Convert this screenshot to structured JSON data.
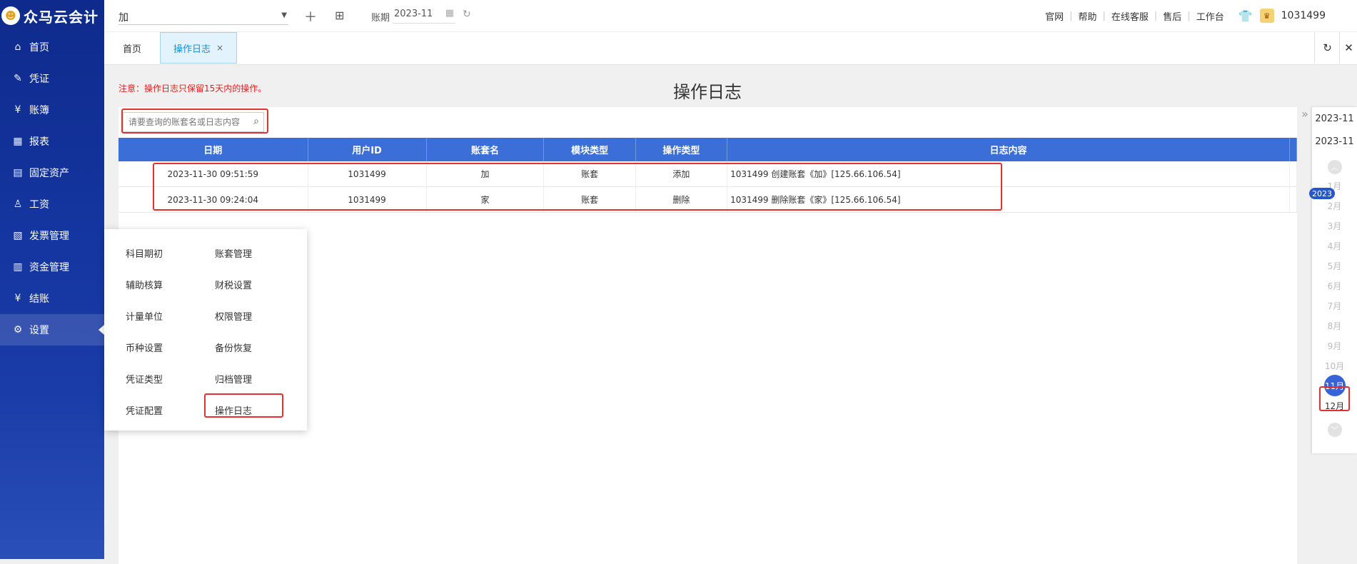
{
  "app": {
    "logo_mark": "☻",
    "logo_text": "众马云会计"
  },
  "sidebar": {
    "items": [
      {
        "icon": "⌂",
        "label": "首页"
      },
      {
        "icon": "✎",
        "label": "凭证"
      },
      {
        "icon": "¥",
        "label": "账簿"
      },
      {
        "icon": "▦",
        "label": "报表"
      },
      {
        "icon": "▤",
        "label": "固定资产"
      },
      {
        "icon": "♙",
        "label": "工资"
      },
      {
        "icon": "▧",
        "label": "发票管理"
      },
      {
        "icon": "▥",
        "label": "资金管理"
      },
      {
        "icon": "¥",
        "label": "结账"
      },
      {
        "icon": "⚙",
        "label": "设置"
      }
    ]
  },
  "topbar": {
    "account_value": "加",
    "period_label": "账期",
    "period_value": "2023-11",
    "links": [
      "官网",
      "帮助",
      "在线客服",
      "售后",
      "工作台"
    ],
    "user_id": "1031499"
  },
  "tabs": {
    "home": "首页",
    "active": "操作日志",
    "close": "×"
  },
  "page": {
    "notice": "注意：操作日志只保留15天内的操作。",
    "title": "操作日志",
    "search_placeholder": "请要查询的账套名或日志内容"
  },
  "table": {
    "headers": [
      "日期",
      "用户ID",
      "账套名",
      "模块类型",
      "操作类型",
      "日志内容"
    ],
    "rows": [
      [
        "2023-11-30 09:51:59",
        "1031499",
        "加",
        "账套",
        "添加",
        "1031499 创建账套《加》[125.66.106.54]"
      ],
      [
        "2023-11-30 09:24:04",
        "1031499",
        "家",
        "账套",
        "删除",
        "1031499 删除账套《家》[125.66.106.54]"
      ]
    ]
  },
  "right_panel": {
    "dates": [
      "2023-11",
      "2023-11"
    ],
    "year": "2023",
    "months": [
      "1月",
      "2月",
      "3月",
      "4月",
      "5月",
      "6月",
      "7月",
      "8月",
      "9月",
      "10月",
      "11月",
      "12月"
    ],
    "selected_month": "11月"
  },
  "settings_menu": {
    "left": [
      "科目期初",
      "辅助核算",
      "计量单位",
      "币种设置",
      "凭证类型",
      "凭证配置"
    ],
    "right": [
      "账套管理",
      "财税设置",
      "权限管理",
      "备份恢复",
      "归档管理",
      "操作日志"
    ]
  }
}
